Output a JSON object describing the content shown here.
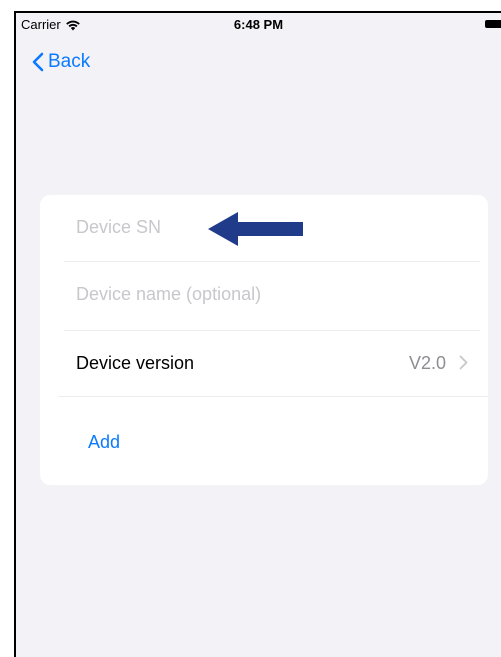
{
  "status_bar": {
    "carrier": "Carrier",
    "time": "6:48 PM"
  },
  "nav": {
    "back_label": "Back"
  },
  "form": {
    "device_sn_placeholder": "Device SN",
    "device_name_placeholder": "Device name (optional)",
    "device_version_label": "Device version",
    "device_version_value": "V2.0",
    "add_label": "Add"
  },
  "colors": {
    "accent": "#0a7aff",
    "background": "#f2f2f7",
    "placeholder": "#c7c7cc",
    "annotation_arrow": "#1f3b8a"
  },
  "icons": [
    "wifi-icon",
    "battery-icon",
    "chevron-left-icon",
    "chevron-right-icon",
    "arrow-left-annotation"
  ]
}
